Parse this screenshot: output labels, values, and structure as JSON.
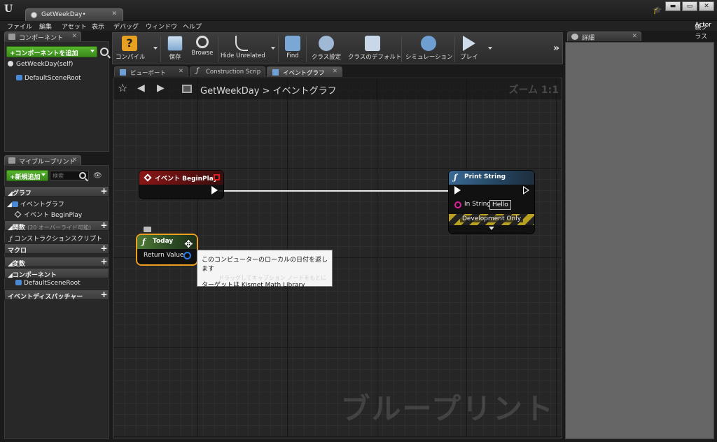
{
  "window": {
    "tab_label": "GetWeekDay•",
    "close_glyph": "✕",
    "controls": [
      "▬",
      "▭",
      "✕"
    ]
  },
  "menu": {
    "items": [
      "ファイル",
      "編集",
      "アセット",
      "表示",
      "デバッグ",
      "ウィンドウ",
      "ヘルプ"
    ],
    "parent_class_label": "親クラス",
    "parent_class_value": "Actor"
  },
  "components_panel": {
    "tab": "コンポーネント",
    "add_button": "+コンポーネントを追加",
    "items": [
      "GetWeekDay(self)",
      "DefaultSceneRoot"
    ]
  },
  "my_blueprint_panel": {
    "tab": "マイブループリント",
    "add_new": "+新規追加",
    "search_placeholder": "検索",
    "categories": {
      "graph": "グラフ",
      "graph_item": "イベントグラフ",
      "graph_subitem": "イベント BeginPlay",
      "functions": "関数",
      "functions_note": "(20 オーバーライド可能)",
      "functions_item": "コンストラクションスクリプト",
      "macros": "マクロ",
      "variables": "変数",
      "components": "コンポーネント",
      "components_item": "DefaultSceneRoot",
      "dispatchers": "イベントディスパッチャー"
    }
  },
  "toolbar": {
    "compile": "コンパイル",
    "save": "保存",
    "browse": "Browse",
    "hide_unrelated": "Hide Unrelated",
    "find": "Find",
    "class_settings": "クラス設定",
    "class_defaults": "クラスのデフォルト",
    "simulation": "シミュレーション",
    "play": "プレイ",
    "more": "»"
  },
  "editor_tabs": [
    "ビューポート",
    "Construction Scrip",
    "イベントグラフ"
  ],
  "graph": {
    "breadcrumb_root": "GetWeekDay",
    "breadcrumb_sep": ">",
    "breadcrumb_current": "イベントグラフ",
    "zoom": "ズーム 1:1",
    "watermark": "ブループリント"
  },
  "nodes": {
    "begin_play": {
      "title": "イベント BeginPlay"
    },
    "print_string": {
      "title": "Print String",
      "in_string_label": "In String",
      "in_string_value": "Hello",
      "dev_only": "Development Only"
    },
    "today": {
      "title": "Today",
      "return_label": "Return Value"
    }
  },
  "tooltip": {
    "line1": "このコンピューターのローカルの日付を返します",
    "line2": "ターゲットは Kismet Math Library",
    "ghost": "ドラッグしてキャプション ノードをもとに"
  },
  "details_panel": {
    "tab": "詳細"
  },
  "colors": {
    "event_header": "#8a1616",
    "function_header": "#3a6a95",
    "pure_header": "#4f7a35",
    "selection": "#f0a020",
    "green_button": "#55b32c"
  }
}
